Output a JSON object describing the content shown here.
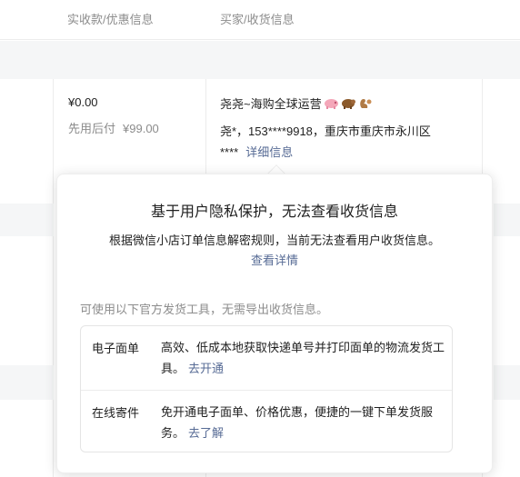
{
  "header": {
    "col_payment": "实收款/优惠信息",
    "col_buyer": "买家/收货信息"
  },
  "order": {
    "amount": "¥0.00",
    "paylater_label": "先用后付",
    "paylater_amount": "¥99.00",
    "buyer_name": "尧尧~海购全球运营",
    "buyer_emojis": [
      "pig-icon",
      "bear-icon",
      "squirrel-icon"
    ],
    "address_line1": "尧*，153****9918，重庆市重庆市永川区",
    "address_line2": "****",
    "detail_link": "详细信息"
  },
  "popover": {
    "title": "基于用户隐私保护，无法查看收货信息",
    "description": "根据微信小店订单信息解密规则，当前无法查看用户收货信息。",
    "more_link": "查看详情",
    "note": "可使用以下官方发货工具，无需导出收货信息。",
    "tools": [
      {
        "name": "电子面单",
        "description": "高效、低成本地获取快递单号并打印面单的物流发货工具。",
        "link": "去开通"
      },
      {
        "name": "在线寄件",
        "description": "免开通电子面单、价格优惠，便捷的一键下单发货服务。",
        "link": "去了解"
      }
    ]
  },
  "colors": {
    "link": "#576b95",
    "muted": "#8c8c8c",
    "band": "#f5f6f7"
  }
}
